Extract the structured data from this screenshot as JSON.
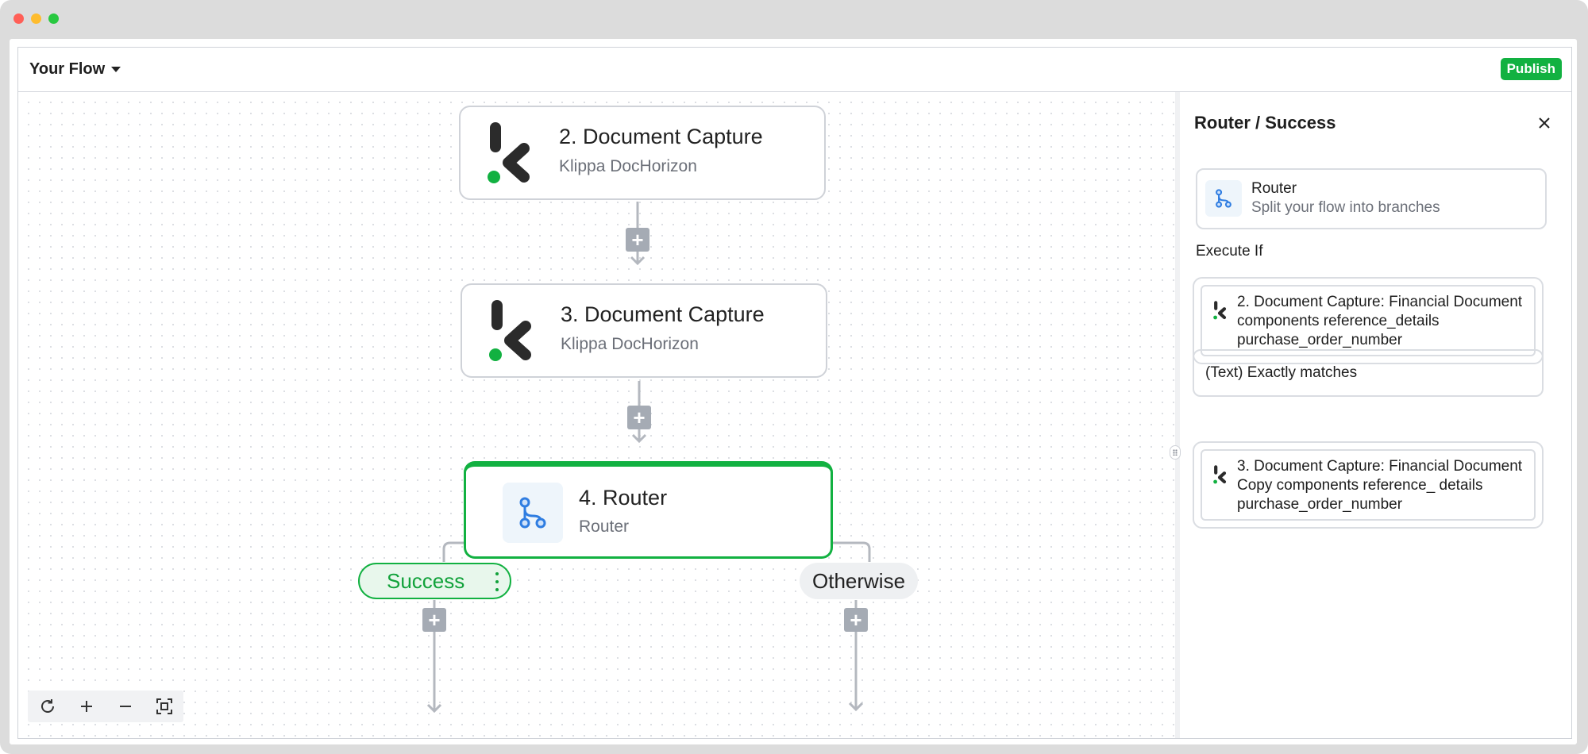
{
  "window": {
    "traffic_lights": [
      "close",
      "minimize",
      "maximize"
    ]
  },
  "header": {
    "flow_title": "Your Flow",
    "publish_label": "Publish"
  },
  "canvas": {
    "nodes": [
      {
        "title": "2. Document Capture",
        "subtitle": "Klippa DocHorizon",
        "icon": "klippa-logo-icon"
      },
      {
        "title": "3. Document Capture",
        "subtitle": "Klippa DocHorizon",
        "icon": "klippa-logo-icon"
      },
      {
        "title": "4. Router",
        "subtitle": "Router",
        "icon": "router-icon"
      }
    ],
    "branches": {
      "success": "Success",
      "otherwise": "Otherwise"
    },
    "add_step_symbol": "+",
    "zoom_controls": [
      "reset-icon",
      "zoom-in-icon",
      "zoom-out-icon",
      "fit-view-icon"
    ]
  },
  "panel": {
    "title": "Router / Success",
    "router_card": {
      "name": "Router",
      "description": "Split your flow into branches"
    },
    "execute_if_label": "Execute If",
    "condition_left": "2. Document Capture: Financial Document components reference_details purchase_order_number",
    "operator": "(Text) Exactly matches",
    "condition_right": "3. Document Capture: Financial Document Copy components reference_ details purchase_order_number"
  },
  "colors": {
    "accent_green": "#12b141",
    "router_blue": "#2f7de1",
    "connector_gray": "#b4b8bf"
  }
}
